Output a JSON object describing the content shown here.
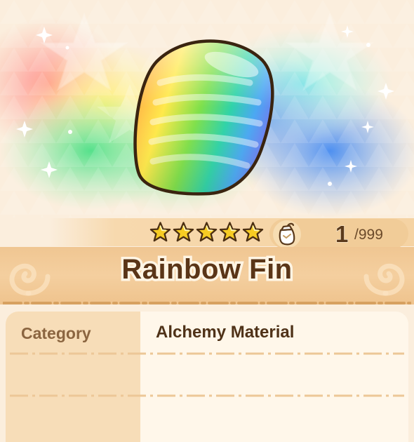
{
  "item": {
    "name": "Rainbow Fin",
    "icon": "rainbow-fin-icon",
    "rarity_stars": 5,
    "owned": "1",
    "max": "/999"
  },
  "details": {
    "rows": [
      {
        "label": "Category",
        "value": "Alchemy Material"
      },
      {
        "label": "",
        "value": ""
      },
      {
        "label": "",
        "value": ""
      }
    ]
  },
  "colors": {
    "background": "#fbeedd",
    "title_band": "#f0c692",
    "title_text": "#5a3517",
    "label_column": "#f7ddb8",
    "value_panel": "#fff7ea",
    "star": "#f7cc23"
  }
}
